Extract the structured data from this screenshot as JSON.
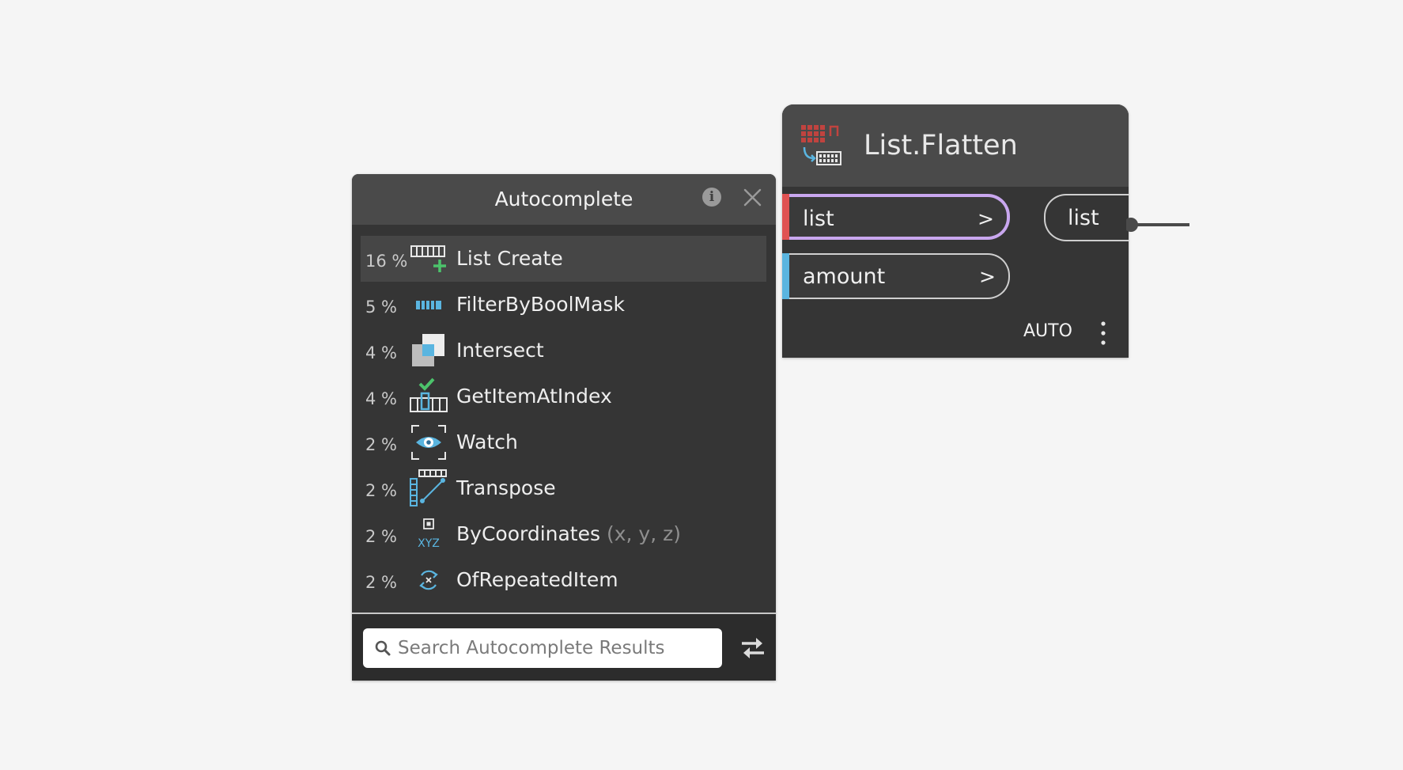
{
  "autocomplete": {
    "title": "Autocomplete",
    "info_glyph": "i",
    "results": [
      {
        "percent": "16 %",
        "label": "List Create",
        "args": "",
        "icon": "list-create-icon",
        "selected": true
      },
      {
        "percent": "5 %",
        "label": "FilterByBoolMask",
        "args": "",
        "icon": "filter-by-bool-mask-icon"
      },
      {
        "percent": "4 %",
        "label": "Intersect",
        "args": "",
        "icon": "intersect-icon"
      },
      {
        "percent": "4 %",
        "label": "GetItemAtIndex",
        "args": "",
        "icon": "get-item-at-index-icon"
      },
      {
        "percent": "2 %",
        "label": "Watch",
        "args": "",
        "icon": "watch-icon"
      },
      {
        "percent": "2 %",
        "label": "Transpose",
        "args": "",
        "icon": "transpose-icon"
      },
      {
        "percent": "2 %",
        "label": "ByCoordinates",
        "args": "(x, y, z)",
        "icon": "by-coordinates-icon",
        "icon_text": "XYZ"
      },
      {
        "percent": "2 %",
        "label": "OfRepeatedItem",
        "args": "",
        "icon": "of-repeated-item-icon"
      }
    ],
    "search": {
      "placeholder": "Search Autocomplete Results",
      "value": ""
    }
  },
  "node": {
    "title": "List.Flatten",
    "icon": "list-flatten-icon",
    "inputs": [
      {
        "name": "list",
        "arrow": ">",
        "color": "#e05252",
        "highlighted": true
      },
      {
        "name": "amount",
        "arrow": ">",
        "color": "#5ab5e0",
        "highlighted": false
      }
    ],
    "output": {
      "name": "list"
    },
    "lacing": "AUTO"
  },
  "colors": {
    "panel_bg": "#353535",
    "header_bg": "#4a4a4a",
    "highlight_outline": "#c9a7ef",
    "icon_blue": "#5ab5e0",
    "icon_green": "#4cc36b",
    "icon_red": "#c0433f"
  }
}
